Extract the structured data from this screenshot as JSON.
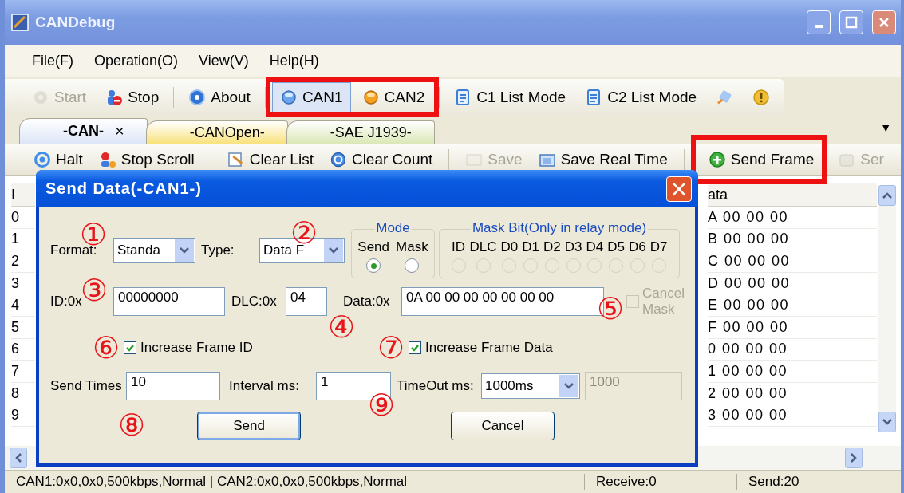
{
  "window": {
    "title": "CANDebug"
  },
  "menu": [
    "File(F)",
    "Operation(O)",
    "View(V)",
    "Help(H)"
  ],
  "toolbar": {
    "groups": [
      {
        "items": [
          {
            "kind": "text",
            "label": "Start",
            "disabled": true
          },
          {
            "kind": "text",
            "label": "Stop",
            "disabled": false
          }
        ]
      },
      {
        "items": [
          {
            "kind": "text",
            "label": "About",
            "disabled": false
          }
        ]
      },
      {
        "highlighted": true,
        "items": [
          {
            "kind": "text",
            "label": "CAN1",
            "disabled": false,
            "selected": true
          },
          {
            "kind": "text",
            "label": "CAN2",
            "disabled": false,
            "selected": false
          }
        ]
      },
      {
        "items": [
          {
            "kind": "text",
            "label": "C1 List Mode",
            "disabled": false
          },
          {
            "kind": "text",
            "label": "C2 List Mode",
            "disabled": false
          },
          {
            "kind": "icon",
            "disabled": false
          },
          {
            "kind": "icon",
            "disabled": false
          }
        ]
      }
    ]
  },
  "tabs": [
    {
      "label": "-CAN-",
      "selected": true,
      "close": "×",
      "color": "#dde6f7"
    },
    {
      "label": "-CANOpen-",
      "selected": false,
      "color": "#f8e27c"
    },
    {
      "label": "-SAE J1939-",
      "selected": false,
      "color": "#dbe7b6"
    }
  ],
  "tab_menu": "▼",
  "actions": {
    "groups": [
      {
        "items": [
          {
            "label": "Halt",
            "disabled": false
          },
          {
            "label": "Stop Scroll",
            "disabled": false
          }
        ]
      },
      {
        "items": [
          {
            "label": "Clear List",
            "disabled": false
          },
          {
            "label": "Clear Count",
            "disabled": false
          }
        ]
      },
      {
        "items": [
          {
            "label": "Save",
            "disabled": true
          },
          {
            "label": "Save Real Time",
            "disabled": false
          }
        ]
      },
      {
        "items": [
          {
            "label": "Send Frame",
            "disabled": false,
            "highlighted": true
          },
          {
            "label": "Ser",
            "disabled": true,
            "highlighted": false
          }
        ]
      }
    ]
  },
  "list": {
    "columns": [
      {
        "header": "I",
        "cells": [
          "0",
          "1",
          "2",
          "3",
          "4",
          "5",
          "6",
          "7",
          "8",
          "9"
        ]
      },
      {
        "header": "ata",
        "cells": [
          "A 00 00 00",
          "B 00 00 00",
          "C 00 00 00",
          "D 00 00 00",
          "E 00 00 00",
          "F 00 00 00",
          "0 00 00 00",
          "1 00 00 00",
          "2 00 00 00",
          "3 00 00 00"
        ]
      }
    ]
  },
  "dialog": {
    "title": "Send Data(-CAN1-)",
    "close": "×",
    "format": {
      "label": "Format:",
      "value": "Standa"
    },
    "type": {
      "label": "Type:",
      "value": "Data F"
    },
    "mode": {
      "legend": "Mode",
      "options": [
        {
          "label": "Send",
          "selected": true
        },
        {
          "label": "Mask",
          "selected": false
        }
      ]
    },
    "mask_bits": {
      "legend": "Mask Bit(Only in relay mode)",
      "disabled": true,
      "bits": [
        {
          "label": "ID",
          "checked": false
        },
        {
          "label": "DLC",
          "checked": false
        },
        {
          "label": "D0",
          "checked": false
        },
        {
          "label": "D1",
          "checked": false
        },
        {
          "label": "D2",
          "checked": false
        },
        {
          "label": "D3",
          "checked": false
        },
        {
          "label": "D4",
          "checked": false
        },
        {
          "label": "D5",
          "checked": false
        },
        {
          "label": "D6",
          "checked": false
        },
        {
          "label": "D7",
          "checked": false
        }
      ]
    },
    "id": {
      "label": "ID:0x",
      "value": "00000000"
    },
    "dlc": {
      "label": "DLC:0x",
      "value": "04"
    },
    "data": {
      "label": "Data:0x",
      "value": "0A 00 00 00 00 00 00 00"
    },
    "cancel_mask": {
      "label": "Cancel Mask",
      "checked": false,
      "disabled": true
    },
    "increase_id": {
      "label": "Increase Frame ID",
      "checked": true
    },
    "increase_data": {
      "label": "Increase Frame Data",
      "checked": true
    },
    "send_times": {
      "label": "Send Times",
      "value": "10"
    },
    "interval": {
      "label": "Interval ms:",
      "value": "1"
    },
    "timeout": {
      "label": "TimeOut ms:",
      "value": "1000ms"
    },
    "timeout_value": {
      "value": "1000",
      "disabled": true
    },
    "buttons": [
      {
        "label": "Send",
        "default": true
      },
      {
        "label": "Cancel",
        "default": false
      }
    ]
  },
  "markers": [
    "①",
    "②",
    "③",
    "④",
    "⑤",
    "⑥",
    "⑦",
    "⑧",
    "⑨"
  ],
  "status_bar": [
    "CAN1:0x0,0x0,500kbps,Normal | CAN2:0x0,0x0,500kbps,Normal",
    "Receive:0",
    "Send:20"
  ]
}
